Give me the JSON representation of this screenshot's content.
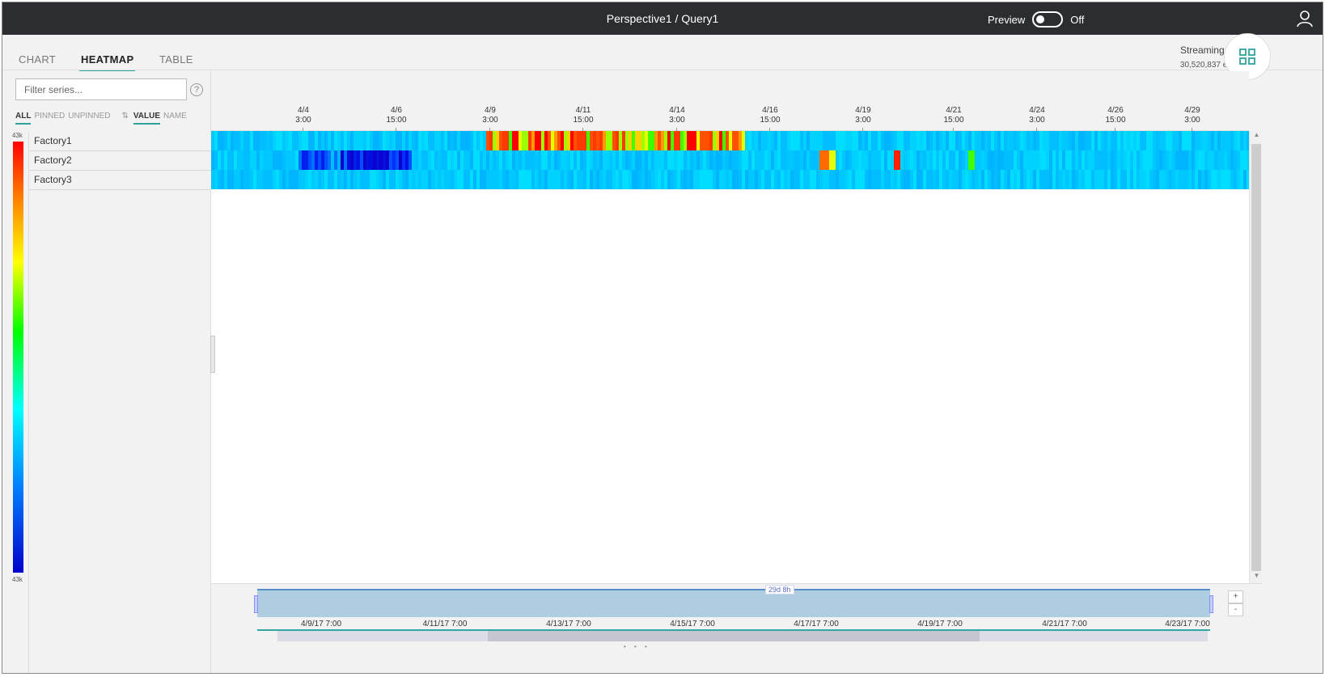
{
  "topbar": {
    "title": "Perspective1 / Query1",
    "preview_label": "Preview",
    "preview_state": "Off"
  },
  "tabs": [
    {
      "label": "CHART",
      "active": false
    },
    {
      "label": "HEATMAP",
      "active": true
    },
    {
      "label": "TABLE",
      "active": false
    }
  ],
  "status": {
    "line1": "Streaming complete.",
    "line2": "30,520,837 events found"
  },
  "filter": {
    "placeholder": "Filter series...",
    "help": "?",
    "scopes": [
      "ALL",
      "PINNED",
      "UNPINNED"
    ],
    "active_scope": "ALL",
    "sort_options": [
      "VALUE",
      "NAME"
    ],
    "active_sort": "VALUE"
  },
  "legend": {
    "max_label": "43k",
    "min_label": "43k"
  },
  "series": [
    "Factory1",
    "Factory2",
    "Factory3"
  ],
  "time_axis": {
    "ticks": [
      {
        "date": "4/4",
        "time": "3:00"
      },
      {
        "date": "4/6",
        "time": "15:00"
      },
      {
        "date": "4/9",
        "time": "3:00"
      },
      {
        "date": "4/11",
        "time": "15:00"
      },
      {
        "date": "4/14",
        "time": "3:00"
      },
      {
        "date": "4/16",
        "time": "15:00"
      },
      {
        "date": "4/19",
        "time": "3:00"
      },
      {
        "date": "4/21",
        "time": "15:00"
      },
      {
        "date": "4/24",
        "time": "3:00"
      },
      {
        "date": "4/26",
        "time": "15:00"
      },
      {
        "date": "4/29",
        "time": "3:00"
      }
    ]
  },
  "brush": {
    "span_label": "29d 8h",
    "ticks": [
      "4/9/17 7:00",
      "4/11/17 7:00",
      "4/13/17 7:00",
      "4/15/17 7:00",
      "4/17/17 7:00",
      "4/19/17 7:00",
      "4/21/17 7:00",
      "4/23/17 7:00"
    ],
    "zoom_in": "+",
    "zoom_out": "-"
  },
  "colors": {
    "topbar_bg": "#2b2d31",
    "accent": "#2fa39b",
    "heat_low": "#0000cc",
    "heat_base": "#00ccff",
    "heat_high": "#ff0000"
  }
}
